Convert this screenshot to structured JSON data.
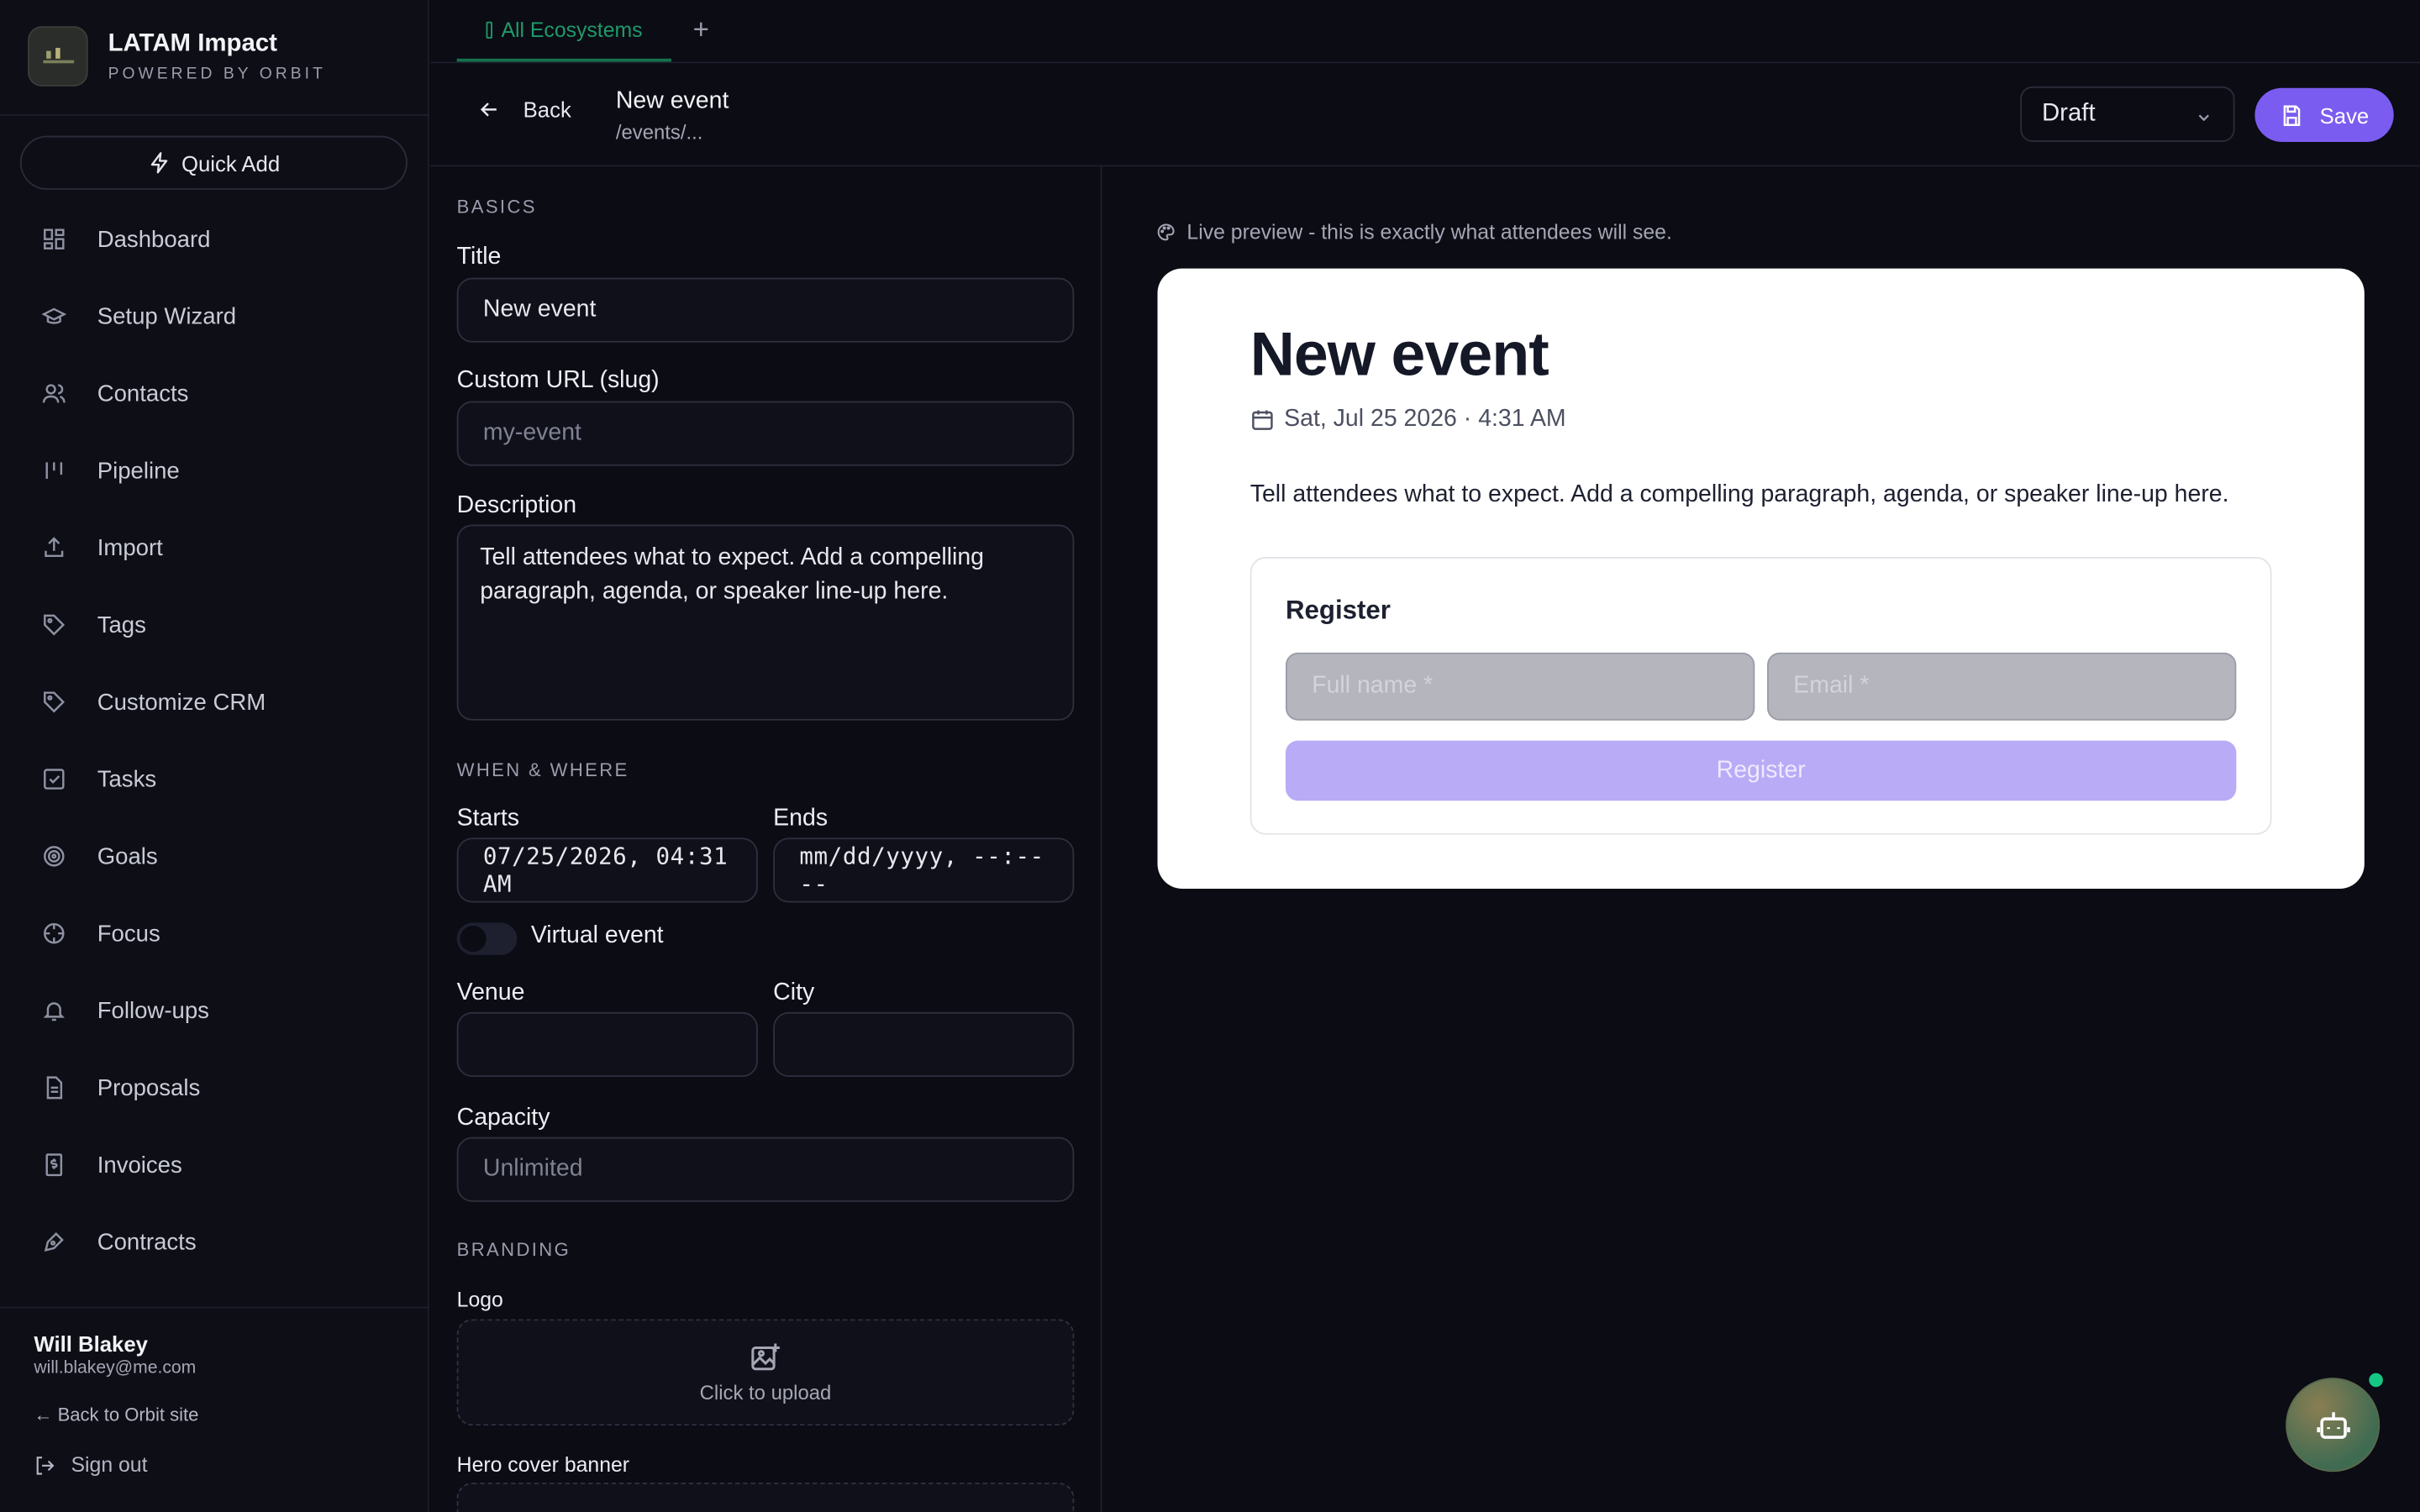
{
  "brand": {
    "name": "LATAM Impact",
    "subtitle": "POWERED BY ORBIT"
  },
  "quick_add_label": "Quick Add",
  "sidebar": {
    "items": [
      {
        "label": "Dashboard",
        "icon": "dashboard-icon"
      },
      {
        "label": "Setup Wizard",
        "icon": "graduation-cap-icon"
      },
      {
        "label": "Contacts",
        "icon": "users-icon"
      },
      {
        "label": "Pipeline",
        "icon": "pipeline-icon"
      },
      {
        "label": "Import",
        "icon": "upload-icon"
      },
      {
        "label": "Tags",
        "icon": "tag-icon"
      },
      {
        "label": "Customize CRM",
        "icon": "tag-icon"
      },
      {
        "label": "Tasks",
        "icon": "checkbox-icon"
      },
      {
        "label": "Goals",
        "icon": "target-icon"
      },
      {
        "label": "Focus",
        "icon": "crosshair-icon"
      },
      {
        "label": "Follow-ups",
        "icon": "bell-icon"
      },
      {
        "label": "Proposals",
        "icon": "document-icon"
      },
      {
        "label": "Invoices",
        "icon": "dollar-receipt-icon"
      },
      {
        "label": "Contracts",
        "icon": "pen-icon"
      }
    ]
  },
  "user": {
    "name": "Will Blakey",
    "email": "will.blakey@me.com",
    "back_link": "← Back to Orbit site",
    "sign_out": "Sign out"
  },
  "tabs": {
    "active_label": "All Ecosystems",
    "add_label": "+"
  },
  "header": {
    "back_label": "Back",
    "title": "New event",
    "path": "/events/...",
    "status": "Draft",
    "save_label": "Save"
  },
  "form": {
    "basics_section": "BASICS",
    "title_label": "Title",
    "title_value": "New event",
    "slug_label": "Custom URL (slug)",
    "slug_placeholder": "my-event",
    "description_label": "Description",
    "description_value": "Tell attendees what to expect. Add a compelling paragraph, agenda, or speaker line-up here.",
    "when_section": "WHEN & WHERE",
    "starts_label": "Starts",
    "starts_value": "07/25/2026, 04:31 AM",
    "ends_label": "Ends",
    "ends_placeholder": "mm/dd/yyyy, --:-- --",
    "virtual_label": "Virtual event",
    "virtual_on": false,
    "venue_label": "Venue",
    "city_label": "City",
    "capacity_label": "Capacity",
    "capacity_placeholder": "Unlimited",
    "branding_section": "BRANDING",
    "logo_label": "Logo",
    "upload_text": "Click to upload",
    "hero_label": "Hero cover banner"
  },
  "preview": {
    "note": "Live preview - this is exactly what attendees will see.",
    "title": "New event",
    "date": "Sat, Jul 25 2026 · 4:31 AM",
    "description": "Tell attendees what to expect. Add a compelling paragraph, agenda, or speaker line-up here.",
    "register_title": "Register",
    "fullname_placeholder": "Full name *",
    "email_placeholder": "Email *",
    "register_button": "Register"
  },
  "colors": {
    "accent": "#7b5cf0",
    "tab_active": "#1f9a6a",
    "background": "#0b0c14",
    "online_dot": "#16c784"
  }
}
